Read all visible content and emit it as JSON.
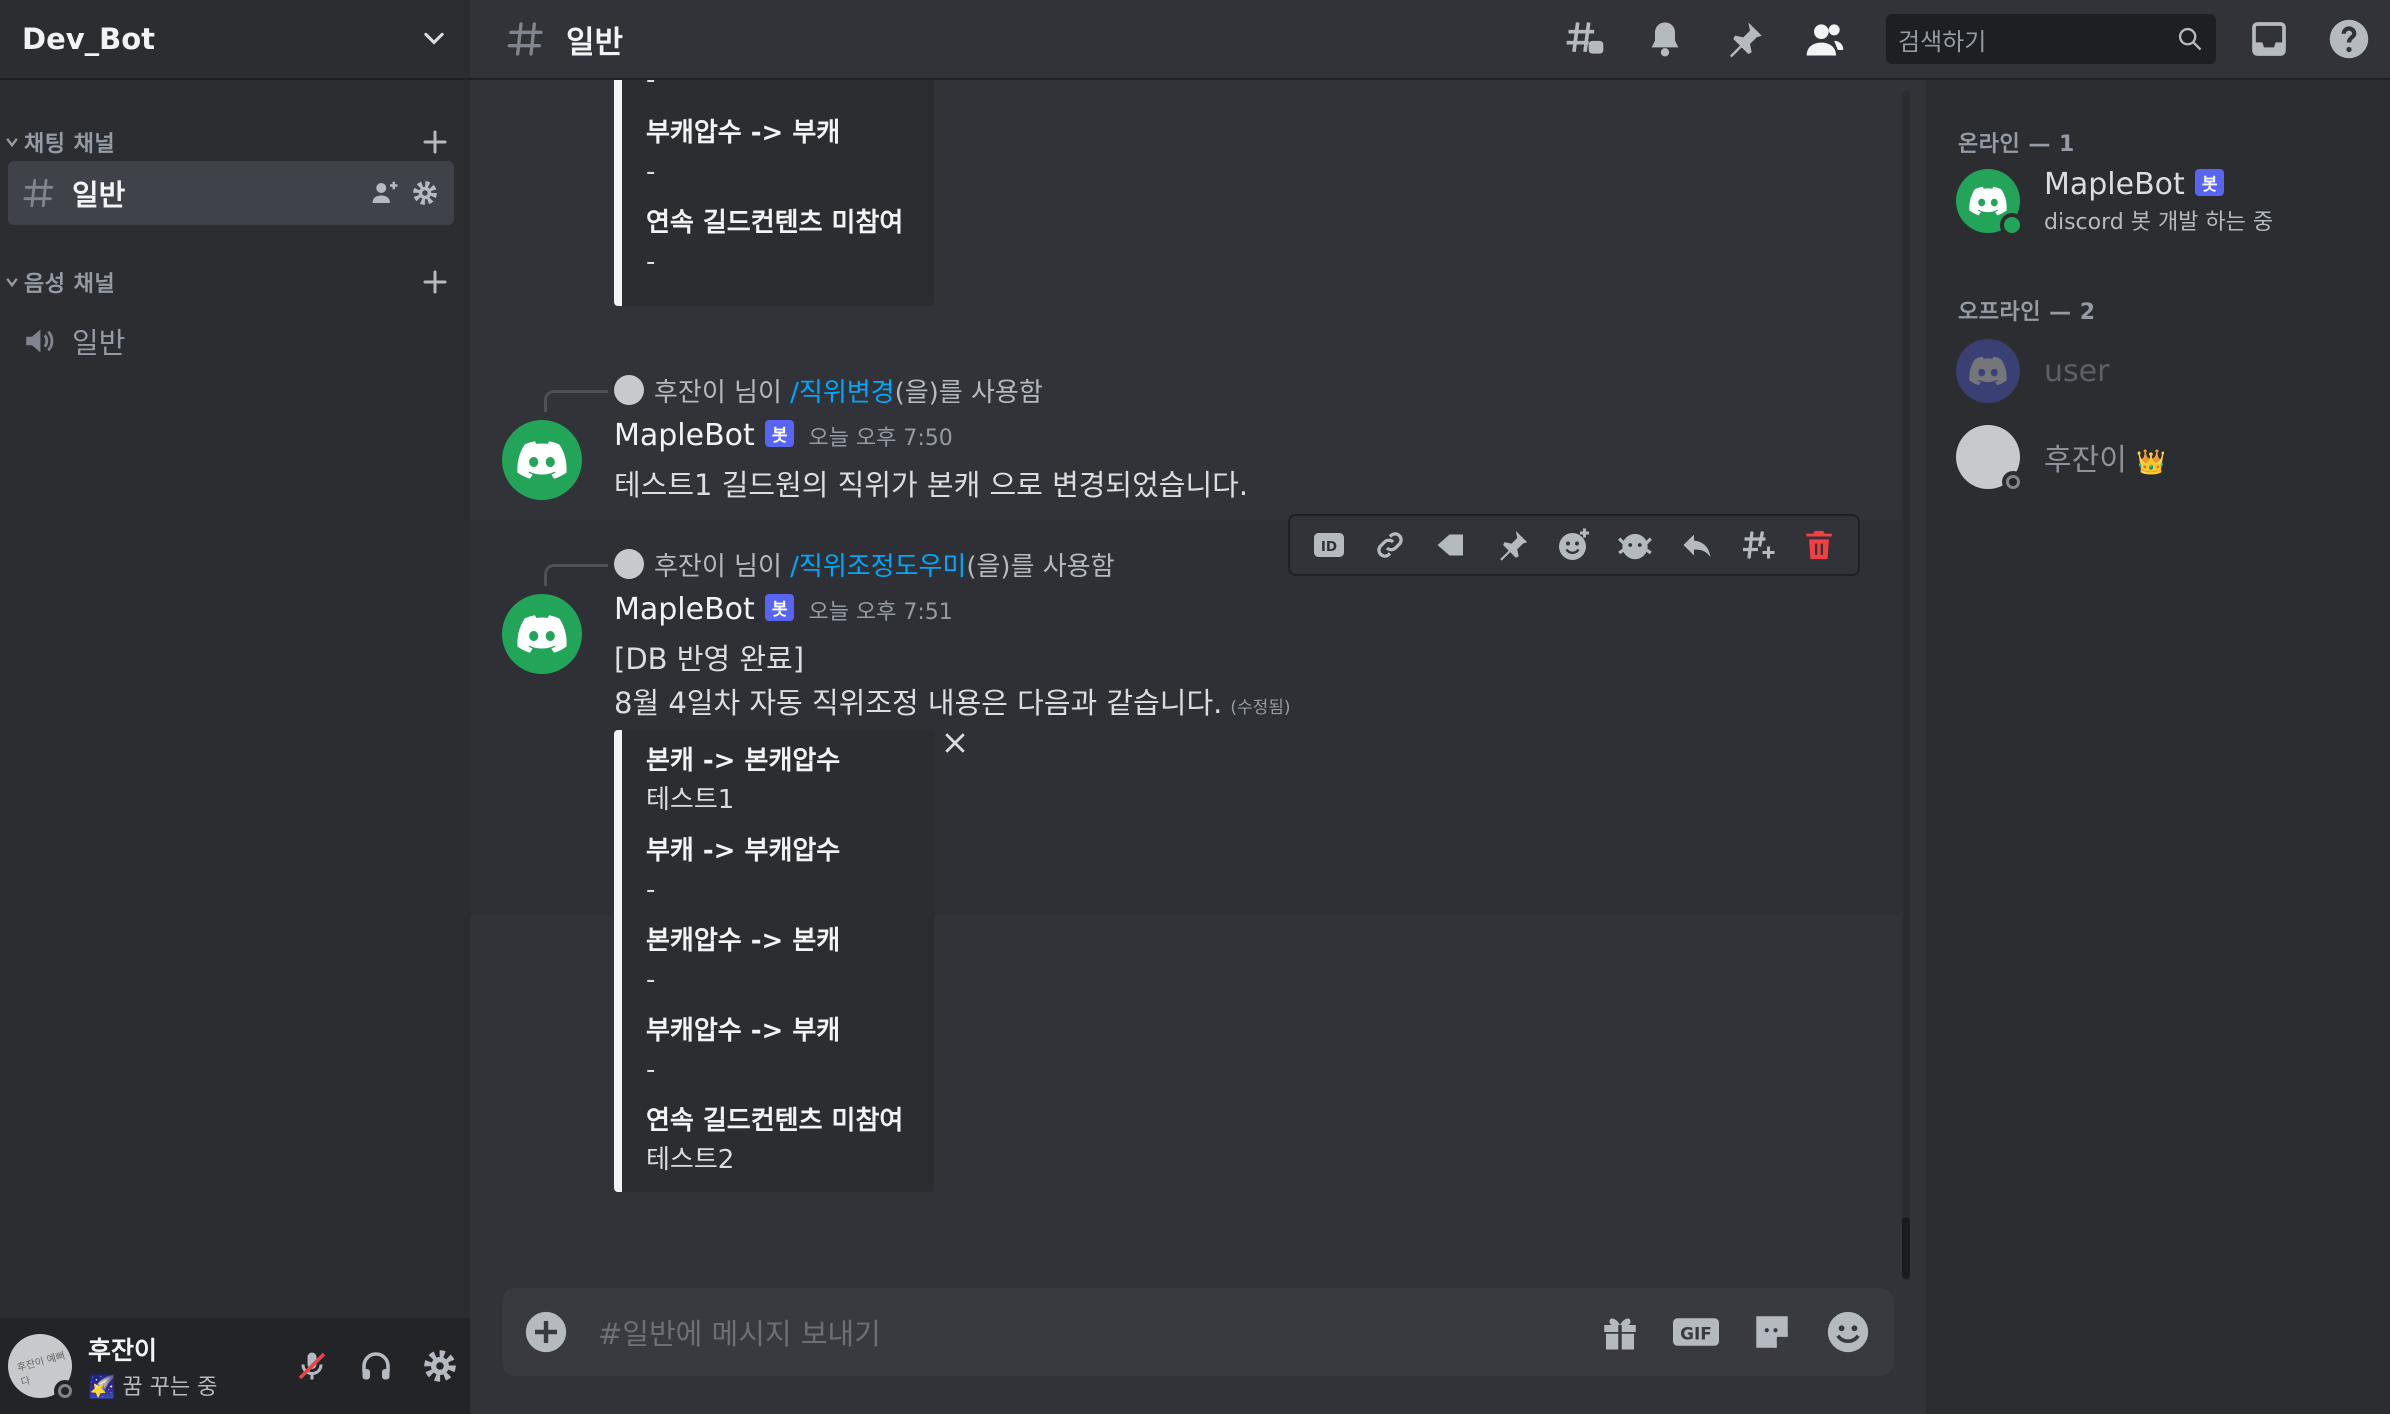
{
  "server": {
    "name": "Dev_Bot"
  },
  "sidebar": {
    "text_category": "채팅 채널",
    "voice_category": "음성 채널",
    "text_channels": [
      {
        "name": "일반",
        "active": true
      }
    ],
    "voice_channels": [
      {
        "name": "일반"
      }
    ]
  },
  "user_panel": {
    "name": "후잔이",
    "status": "꿈 꾸는 중",
    "status_emoji": "🌠",
    "avatar_text": "후잔이 예뻐다"
  },
  "header": {
    "channel_name": "일반",
    "search_placeholder": "검색하기"
  },
  "messages": [
    {
      "partial_embed": {
        "fields": [
          {
            "name": "",
            "value": "-"
          },
          {
            "name": "부캐압수 -> 부캐",
            "value": "-"
          },
          {
            "name": "연속 길드컨텐츠 미참여",
            "value": "-"
          }
        ]
      }
    },
    {
      "interaction": {
        "user": "후잔이 님이",
        "command": "/직위변경",
        "suffix": "(을)를 사용함"
      },
      "author": "MapleBot",
      "badge": "봇",
      "timestamp": "오늘 오후 7:50",
      "text": "테스트1 길드원의 직위가 본캐 으로 변경되었습니다."
    },
    {
      "interaction": {
        "user": "후잔이 님이",
        "command": "/직위조정도우미",
        "suffix": "(을)를 사용함"
      },
      "author": "MapleBot",
      "badge": "봇",
      "timestamp": "오늘 오후 7:51",
      "lines": [
        "[DB 반영 완료]",
        "8월 4일차 자동 직위조정 내용은 다음과 같습니다."
      ],
      "edited": "(수정됨)",
      "embed": {
        "fields": [
          {
            "name": "본캐 -> 본캐압수",
            "value": "테스트1"
          },
          {
            "name": "부캐 -> 부캐압수",
            "value": "-"
          },
          {
            "name": "본캐압수 -> 본캐",
            "value": "-"
          },
          {
            "name": "부캐압수 -> 부캐",
            "value": "-"
          },
          {
            "name": "연속 길드컨텐츠 미참여",
            "value": "테스트2"
          }
        ]
      }
    }
  ],
  "composer": {
    "placeholder": "#일반에 메시지 보내기",
    "gif_label": "GIF"
  },
  "members": {
    "online_header": "온라인 — 1",
    "offline_header": "오프라인 — 2",
    "online": [
      {
        "name": "MapleBot",
        "badge": "봇",
        "activity": "discord 봇 개발 하는 중"
      }
    ],
    "offline": [
      {
        "name": "user"
      },
      {
        "name": "후잔이",
        "crown": "👑"
      }
    ]
  },
  "colors": {
    "accent": "#5865f2",
    "online": "#23a559",
    "link": "#00a8fc",
    "danger": "#f23f42"
  }
}
